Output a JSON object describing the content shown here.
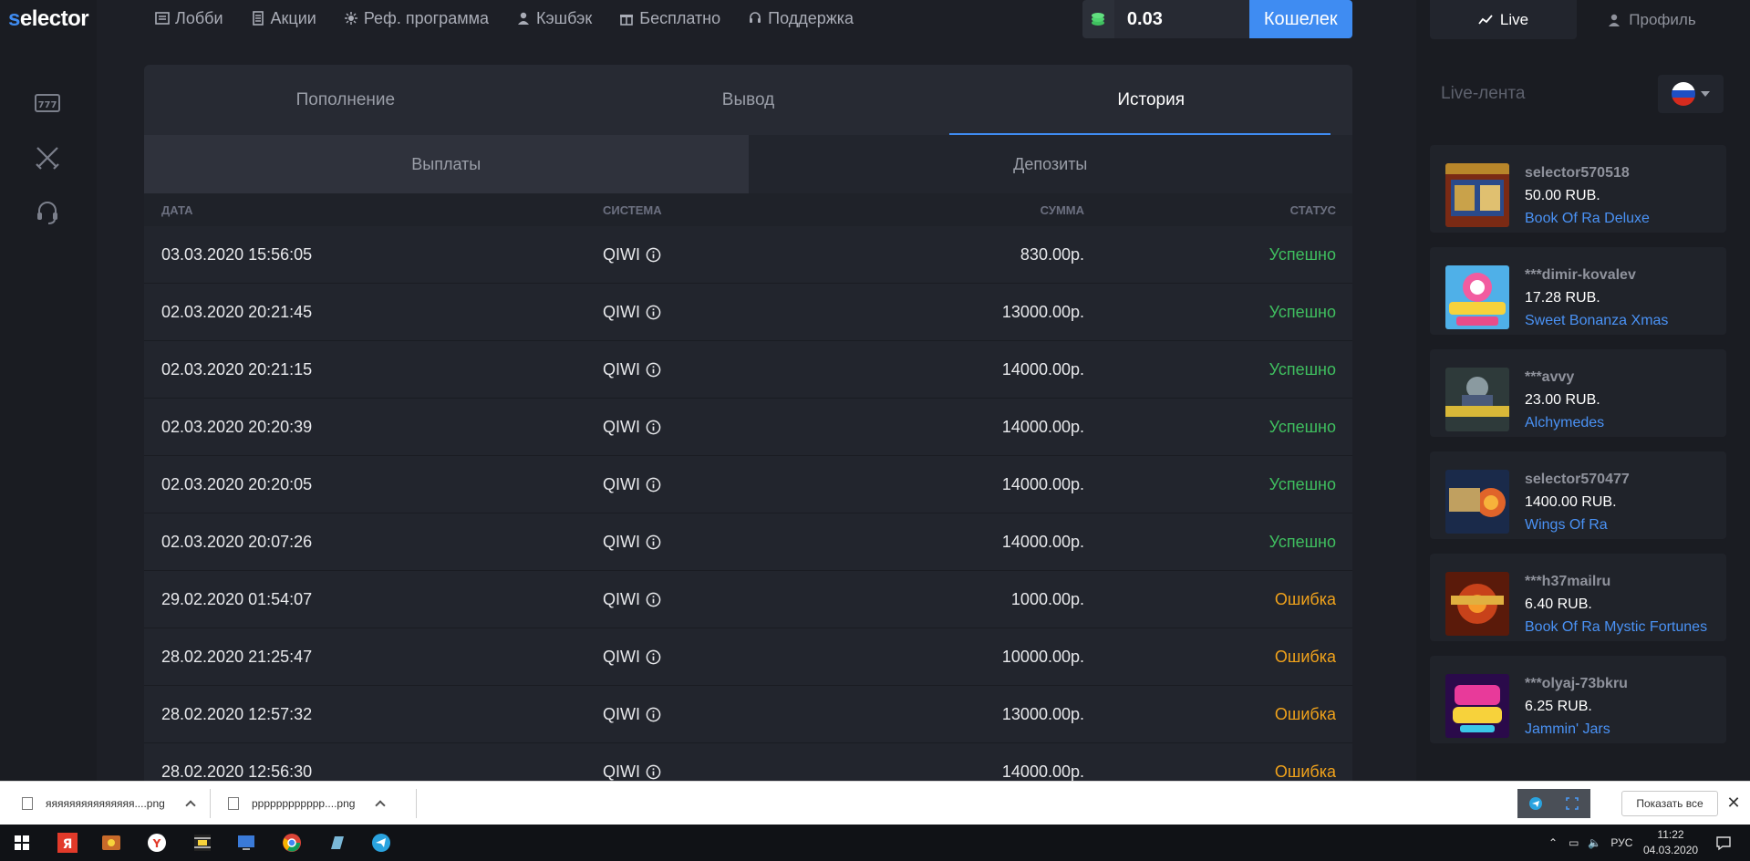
{
  "logo": {
    "s": "s",
    "rest": "elector"
  },
  "nav": [
    {
      "label": "Лобби",
      "icon": "lobby-icon"
    },
    {
      "label": "Акции",
      "icon": "promo-icon"
    },
    {
      "label": "Реф. программа",
      "icon": "referral-icon"
    },
    {
      "label": "Кэшбэк",
      "icon": "cashback-icon"
    },
    {
      "label": "Бесплатно",
      "icon": "gift-icon"
    },
    {
      "label": "Поддержка",
      "icon": "headset-icon"
    }
  ],
  "wallet": {
    "balance": "0.03",
    "button": "Кошелек"
  },
  "tabs": [
    "Пополнение",
    "Вывод",
    "История"
  ],
  "subtabs": [
    "Выплаты",
    "Депозиты"
  ],
  "table": {
    "headers": {
      "date": "ДАТА",
      "system": "СИСТЕМА",
      "sum": "СУММА",
      "status": "СТАТУС"
    },
    "rows": [
      {
        "date": "03.03.2020 15:56:05",
        "system": "QIWI",
        "sum": "830.00р.",
        "status": "Успешно",
        "ok": true
      },
      {
        "date": "02.03.2020 20:21:45",
        "system": "QIWI",
        "sum": "13000.00р.",
        "status": "Успешно",
        "ok": true
      },
      {
        "date": "02.03.2020 20:21:15",
        "system": "QIWI",
        "sum": "14000.00р.",
        "status": "Успешно",
        "ok": true
      },
      {
        "date": "02.03.2020 20:20:39",
        "system": "QIWI",
        "sum": "14000.00р.",
        "status": "Успешно",
        "ok": true
      },
      {
        "date": "02.03.2020 20:20:05",
        "system": "QIWI",
        "sum": "14000.00р.",
        "status": "Успешно",
        "ok": true
      },
      {
        "date": "02.03.2020 20:07:26",
        "system": "QIWI",
        "sum": "14000.00р.",
        "status": "Успешно",
        "ok": true
      },
      {
        "date": "29.02.2020 01:54:07",
        "system": "QIWI",
        "sum": "1000.00р.",
        "status": "Ошибка",
        "ok": false
      },
      {
        "date": "28.02.2020 21:25:47",
        "system": "QIWI",
        "sum": "10000.00р.",
        "status": "Ошибка",
        "ok": false
      },
      {
        "date": "28.02.2020 12:57:32",
        "system": "QIWI",
        "sum": "13000.00р.",
        "status": "Ошибка",
        "ok": false
      },
      {
        "date": "28.02.2020 12:56:30",
        "system": "QIWI",
        "sum": "14000.00р.",
        "status": "Ошибка",
        "ok": false
      }
    ]
  },
  "right": {
    "live_tab": "Live",
    "profile_tab": "Профиль",
    "feed_title": "Live-лента",
    "feed": [
      {
        "user": "selector570518",
        "amount": "50.00 RUB.",
        "game": "Book Of Ra Deluxe"
      },
      {
        "user": "***dimir-kovalev",
        "amount": "17.28 RUB.",
        "game": "Sweet Bonanza Xmas"
      },
      {
        "user": "***avvy",
        "amount": "23.00 RUB.",
        "game": "Alchymedes"
      },
      {
        "user": "selector570477",
        "amount": "1400.00 RUB.",
        "game": "Wings Of Ra"
      },
      {
        "user": "***h37mailru",
        "amount": "6.40 RUB.",
        "game": "Book Of Ra Mystic Fortunes"
      },
      {
        "user": "***olyaj-73bkru",
        "amount": "6.25 RUB.",
        "game": "Jammin' Jars"
      }
    ]
  },
  "downloads": {
    "files": [
      "яяяяяяяяяяяяяяя....png",
      "рррррррррррр....png"
    ],
    "show_all": "Показать все",
    "close": "✕"
  },
  "taskbar": {
    "lang": "РУС",
    "time": "11:22",
    "date": "04.03.2020"
  },
  "colors": {
    "accent": "#3f8cf2",
    "success": "#3fbf5f",
    "error": "#f0a21b"
  }
}
